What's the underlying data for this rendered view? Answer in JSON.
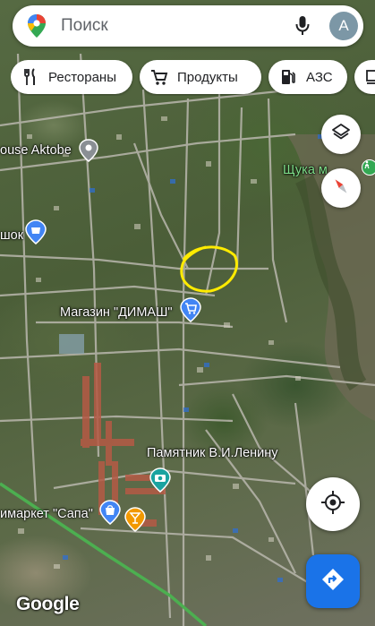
{
  "search": {
    "placeholder": "Поиск",
    "avatar_letter": "A"
  },
  "chips": [
    {
      "label": "Рестораны",
      "icon": "fork-knife-icon"
    },
    {
      "label": "Продукты",
      "icon": "cart-icon"
    },
    {
      "label": "АЗС",
      "icon": "gas-pump-icon"
    },
    {
      "label": "",
      "icon": "coffee-cup-icon"
    }
  ],
  "map_labels": {
    "house_aktobe": "ouse Aktobe",
    "shchuka": "Щука м",
    "shchuka_partial": "а",
    "shok": "шок",
    "magazin": "Магазин \"ДИМАШ\"",
    "pamyatnik": "Памятник В.И.Ленину",
    "supermarket": "имаркет \"Сапа\""
  },
  "branding": {
    "google": "Google"
  },
  "colors": {
    "accent": "#1a73e8",
    "annotation": "#ffeb00",
    "poi_blue": "#4285f4",
    "poi_teal": "#1aa3a0",
    "poi_orange": "#f29900"
  }
}
